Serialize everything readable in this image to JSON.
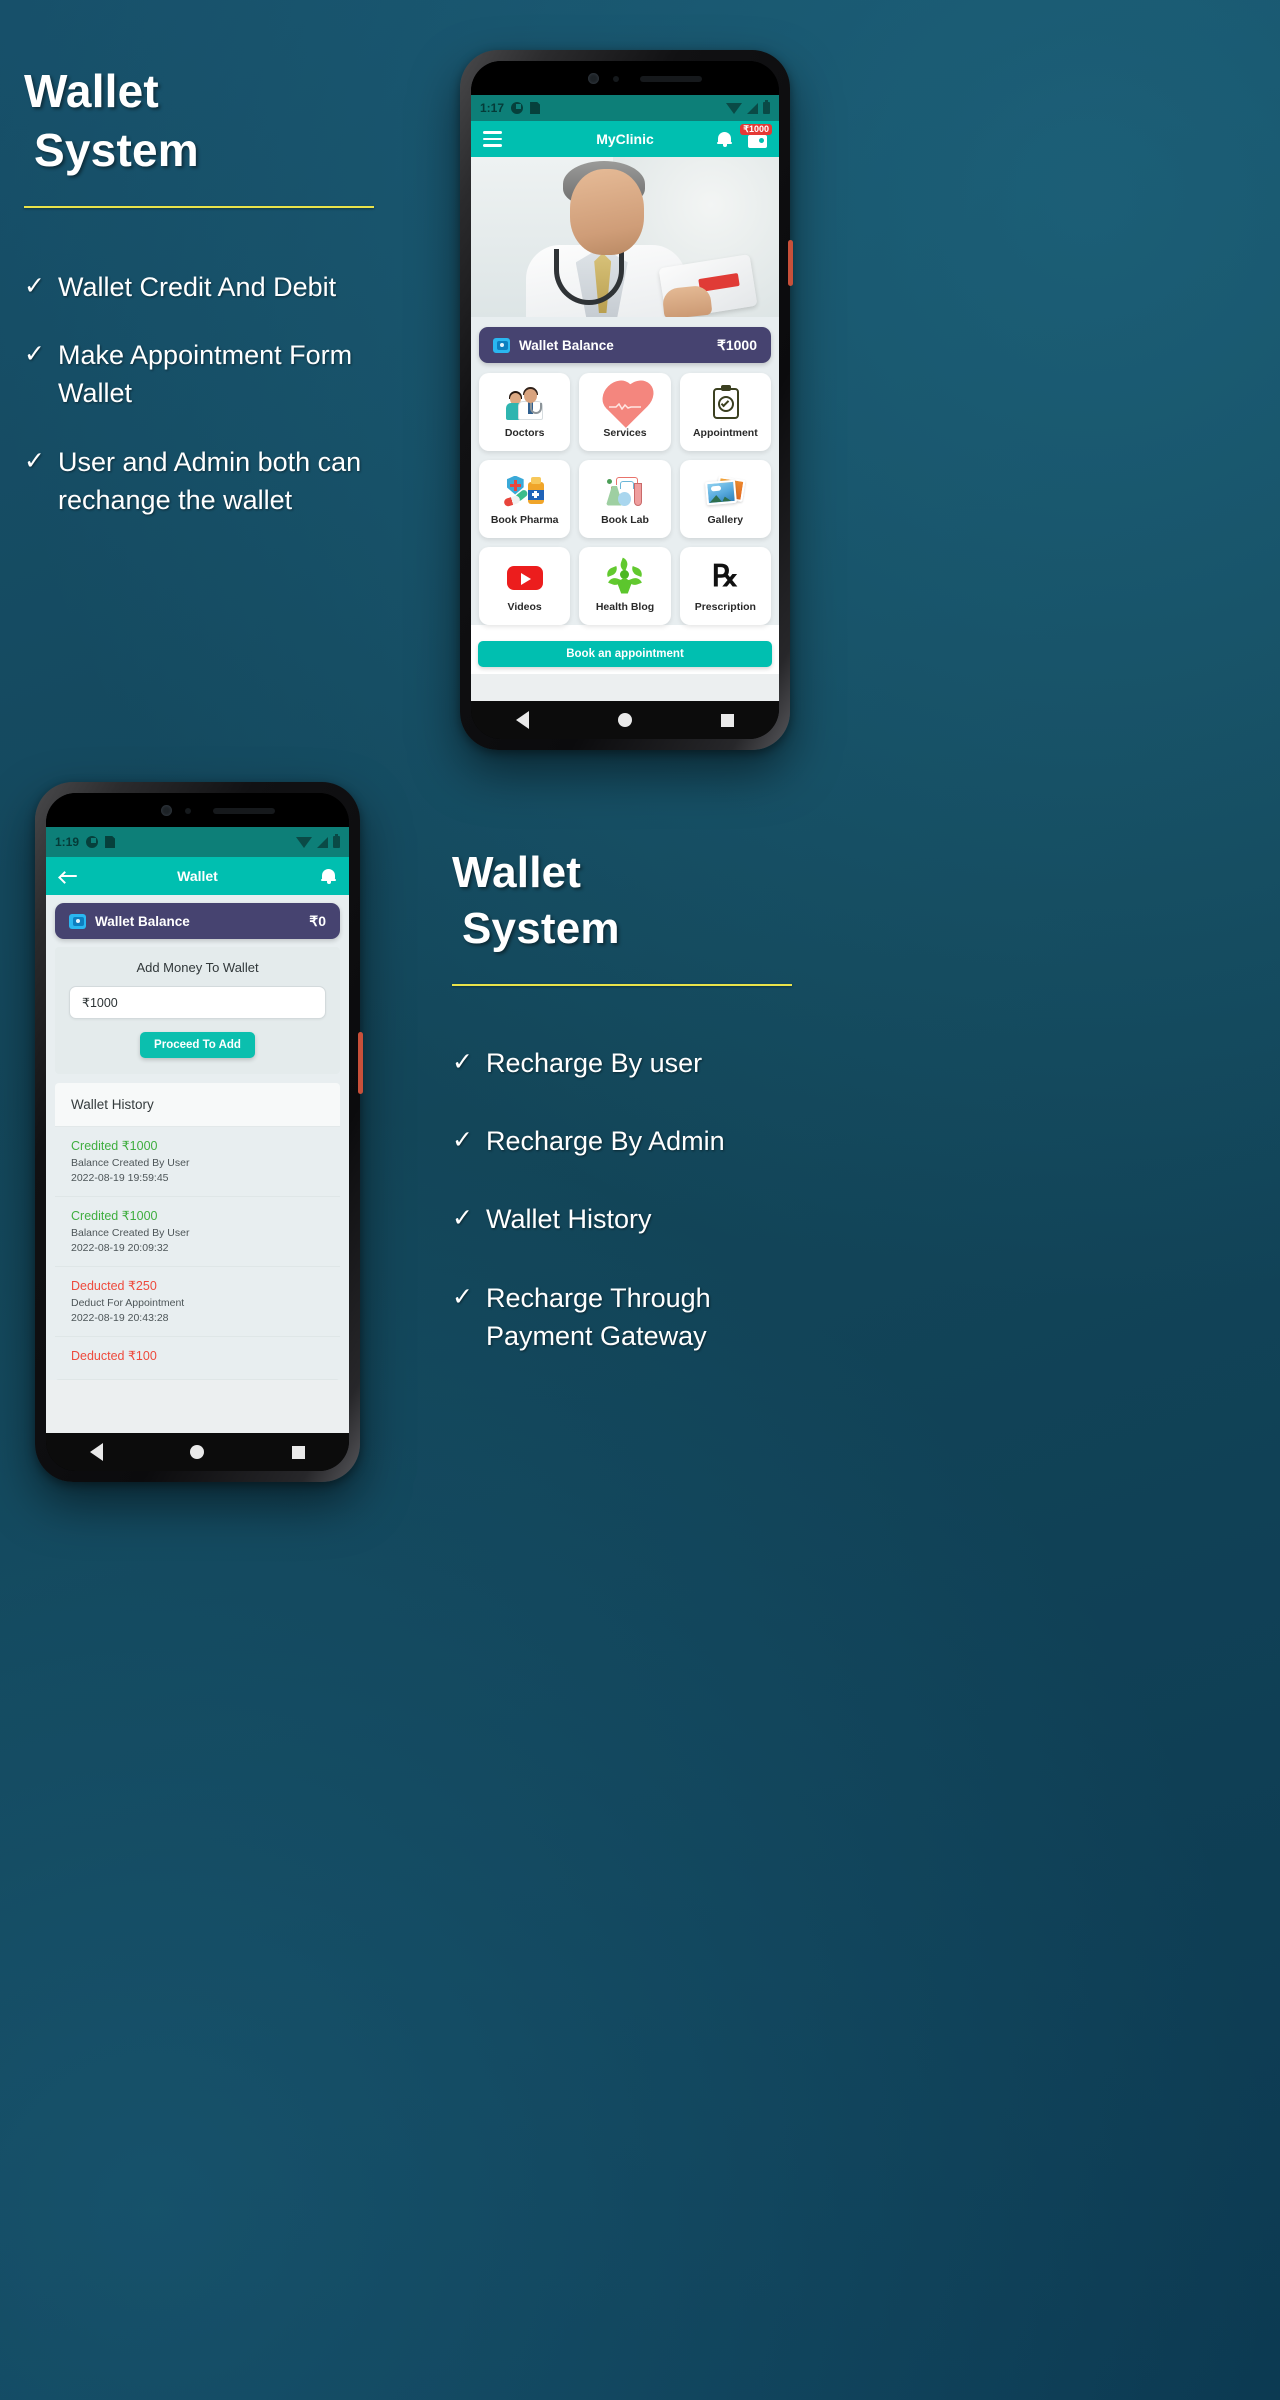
{
  "slide_top": {
    "title_line1": "Wallet",
    "title_line2": "System",
    "bullets": [
      "Wallet Credit And Debit",
      "Make Appointment Form Wallet",
      "User and Admin both can rechange the wallet"
    ],
    "tick": "✓"
  },
  "slide_bottom": {
    "title_line1": "Wallet",
    "title_line2": "System",
    "bullets": [
      "Recharge By user",
      "Recharge By Admin",
      "Wallet History",
      "Recharge Through Payment Gateway"
    ],
    "tick": "✓"
  },
  "phone_home": {
    "statusbar": {
      "time": "1:17",
      "clock_icon": "clock-icon",
      "sd_icon": "sd-card-icon",
      "wifi_icon": "wifi-icon",
      "signal_icon": "signal-icon",
      "battery_icon": "battery-icon"
    },
    "appbar": {
      "menu_icon": "hamburger-menu-icon",
      "title": "MyClinic",
      "bell_icon": "notification-bell-icon",
      "wallet_icon": "wallet-icon",
      "wallet_badge": "₹1000"
    },
    "wallet_bar": {
      "icon": "wallet-icon",
      "label": "Wallet Balance",
      "amount": "₹1000"
    },
    "tiles": [
      {
        "label": "Doctors",
        "icon": "doctors-icon"
      },
      {
        "label": "Services",
        "icon": "heart-pulse-icon"
      },
      {
        "label": "Appointment",
        "icon": "clipboard-stethoscope-icon"
      },
      {
        "label": "Book Pharma",
        "icon": "pharmacy-icon"
      },
      {
        "label": "Book Lab",
        "icon": "lab-flask-icon"
      },
      {
        "label": "Gallery",
        "icon": "photos-icon"
      },
      {
        "label": "Videos",
        "icon": "youtube-icon"
      },
      {
        "label": "Health Blog",
        "icon": "health-leaf-icon"
      },
      {
        "label": "Prescription",
        "icon": "rx-icon"
      }
    ],
    "cta": "Book an appointment",
    "rx_glyph": "℞",
    "navbar": {
      "back": "back-nav-icon",
      "home": "home-nav-icon",
      "recents": "recents-nav-icon"
    }
  },
  "phone_wallet": {
    "statusbar": {
      "time": "1:19",
      "clock_icon": "clock-icon",
      "sd_icon": "sd-card-icon",
      "wifi_icon": "wifi-icon",
      "signal_icon": "signal-icon",
      "battery_icon": "battery-icon"
    },
    "appbar": {
      "back_icon": "back-arrow-icon",
      "title": "Wallet",
      "bell_icon": "notification-bell-icon"
    },
    "wallet_bar": {
      "icon": "wallet-icon",
      "label": "Wallet Balance",
      "amount": "₹0"
    },
    "add_money": {
      "title": "Add Money To Wallet",
      "amount_value": "₹1000",
      "amount_placeholder": "₹1000",
      "button": "Proceed To Add"
    },
    "history_title": "Wallet History",
    "history": [
      {
        "amount": "Credited ₹1000",
        "type": "credit",
        "desc": "Balance Created By User",
        "date": "2022-08-19 19:59:45"
      },
      {
        "amount": "Credited ₹1000",
        "type": "credit",
        "desc": "Balance Created By User",
        "date": "2022-08-19 20:09:32"
      },
      {
        "amount": "Deducted ₹250",
        "type": "debit",
        "desc": "Deduct For Appointment",
        "date": "2022-08-19 20:43:28"
      },
      {
        "amount": "Deducted ₹100",
        "type": "debit",
        "desc": "",
        "date": ""
      }
    ],
    "navbar": {
      "back": "back-nav-icon",
      "home": "home-nav-icon",
      "recents": "recents-nav-icon"
    }
  },
  "colors": {
    "background": "#14455a",
    "accent_rule": "#e9e34a",
    "teal": "#00bfb0",
    "teal_dark": "#0d7f78",
    "wallet_card": "#464370",
    "credit_green": "#3fae3f",
    "debit_red": "#ee4a3c",
    "badge_red": "#e53935"
  }
}
